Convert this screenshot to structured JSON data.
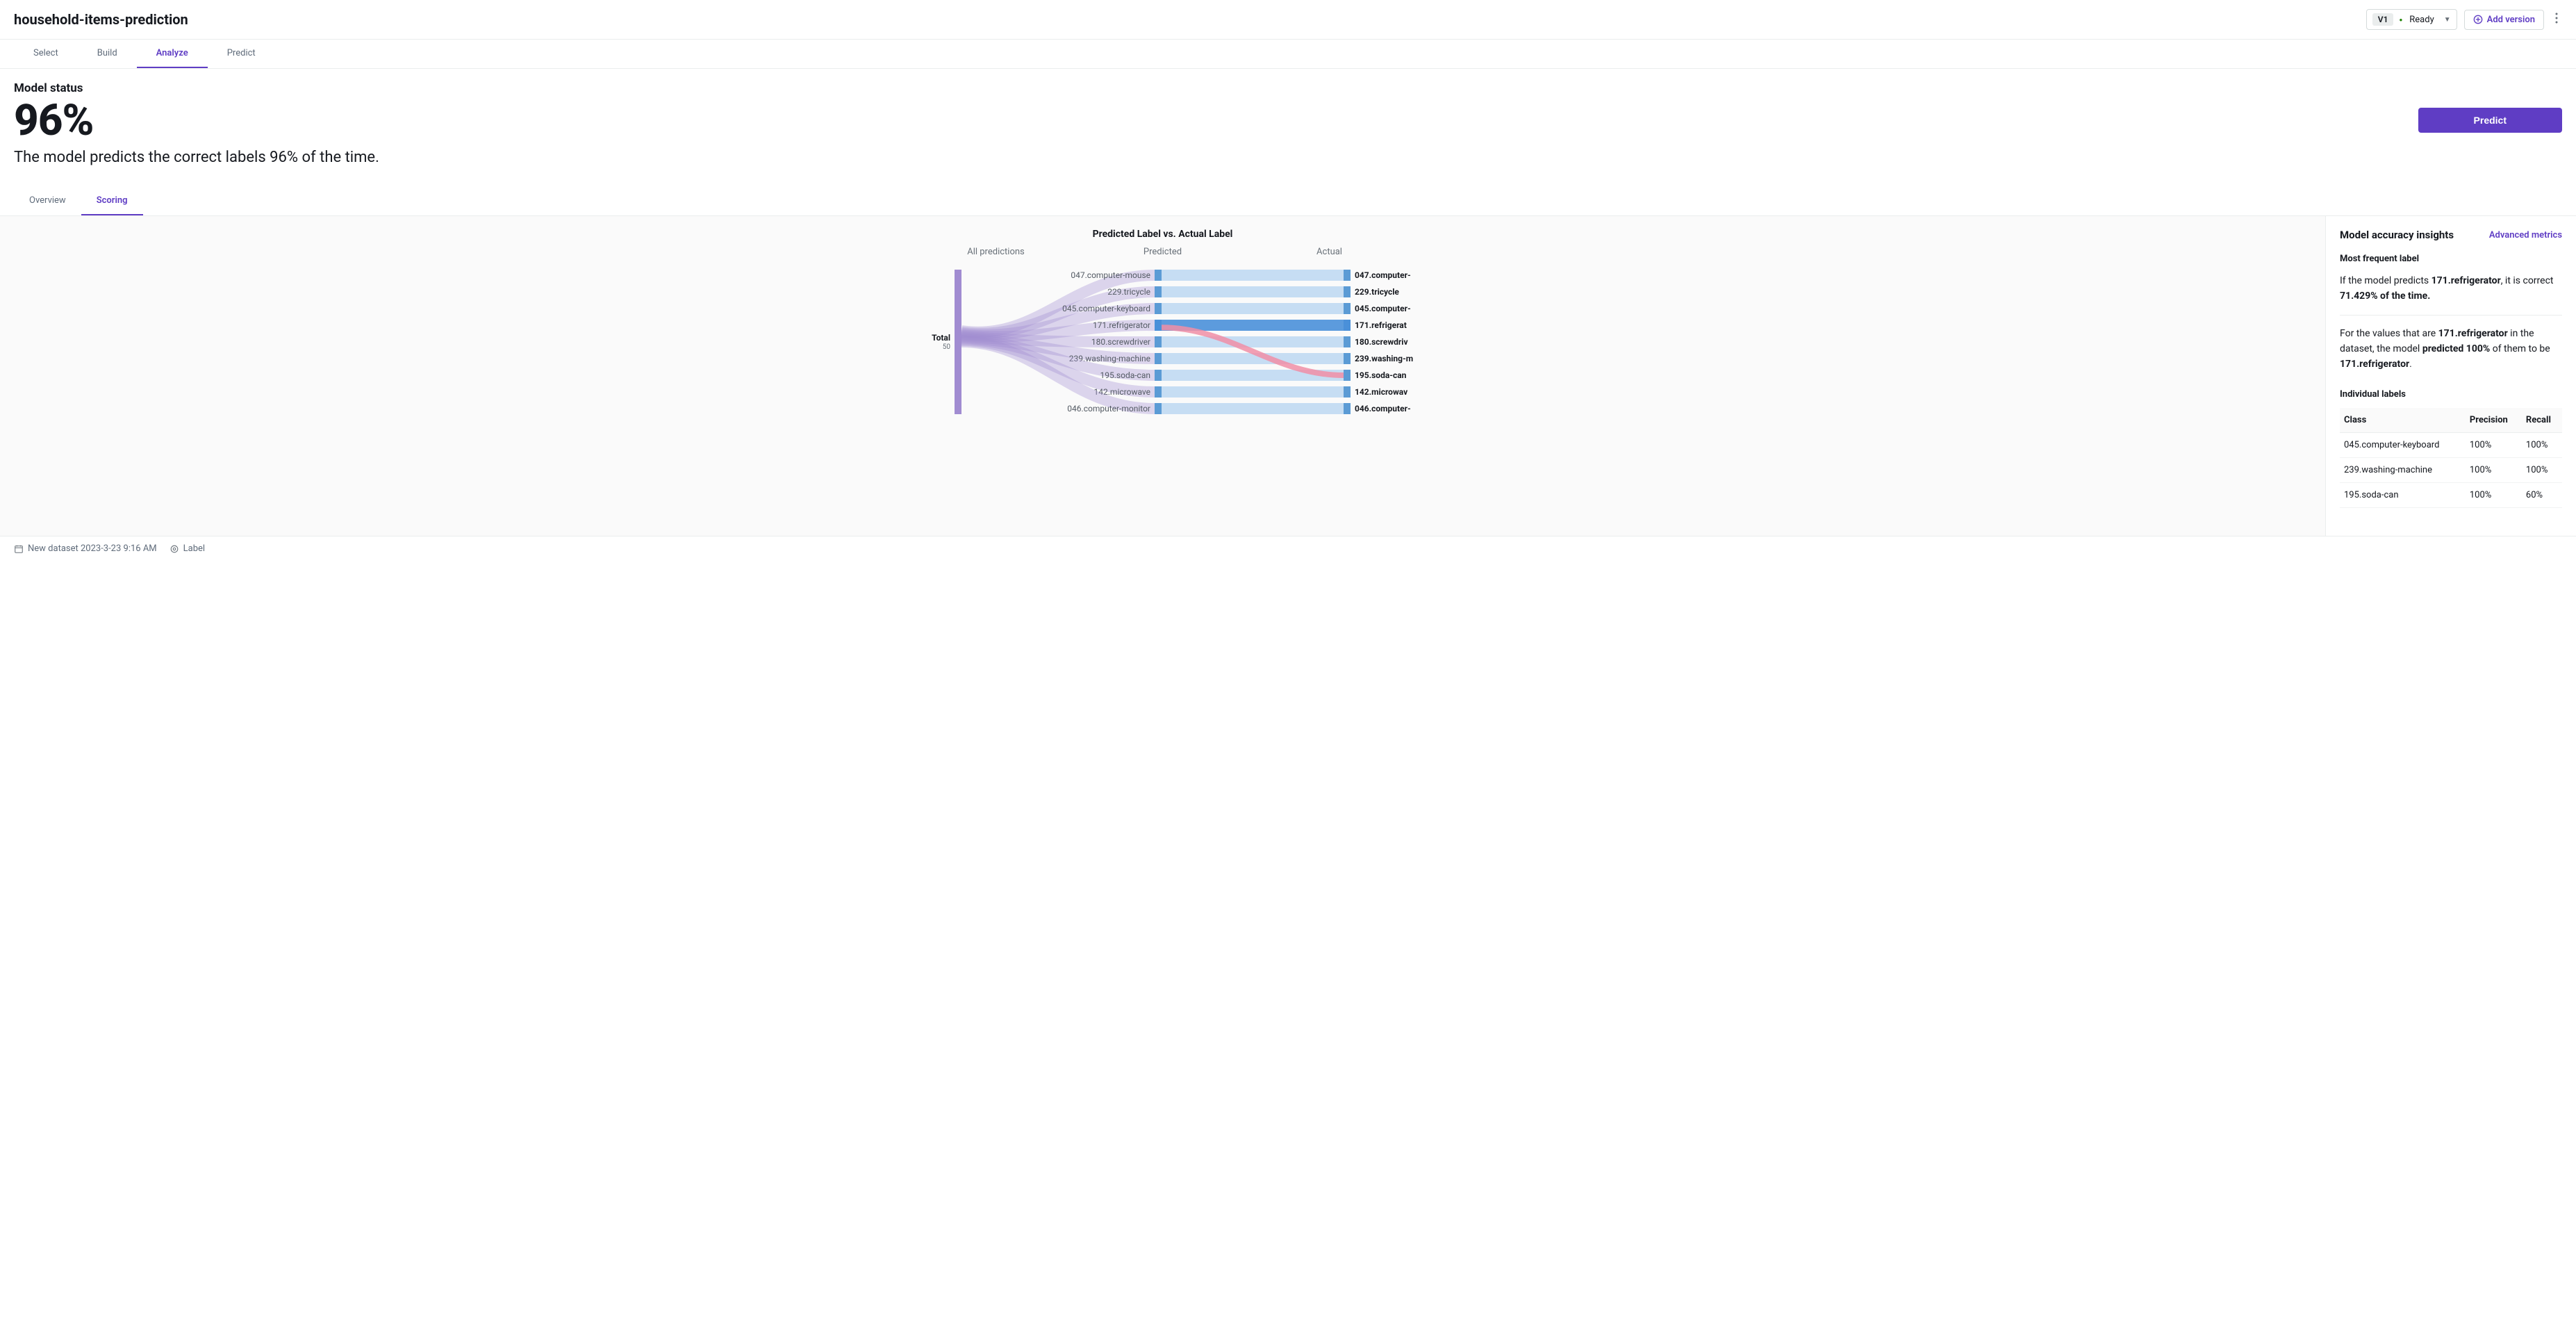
{
  "header": {
    "title": "household-items-prediction",
    "version": "V1",
    "status": "Ready",
    "add_version": "Add version"
  },
  "tabs": {
    "select": "Select",
    "build": "Build",
    "analyze": "Analyze",
    "predict": "Predict"
  },
  "model_status": {
    "heading": "Model status",
    "percent": "96%",
    "description": "The model predicts the correct labels 96% of the time.",
    "predict_btn": "Predict"
  },
  "subtabs": {
    "overview": "Overview",
    "scoring": "Scoring"
  },
  "chart": {
    "title": "Predicted Label vs. Actual Label",
    "col_all": "All predictions",
    "col_pred": "Predicted",
    "col_actual": "Actual",
    "total_label": "Total",
    "total_n": "50"
  },
  "chart_data": {
    "type": "sankey",
    "title": "Predicted Label vs. Actual Label",
    "total": 50,
    "predicted": [
      {
        "label": "047.computer-mouse"
      },
      {
        "label": "229.tricycle"
      },
      {
        "label": "045.computer-keyboard"
      },
      {
        "label": "171.refrigerator"
      },
      {
        "label": "180.screwdriver"
      },
      {
        "label": "239.washing-machine"
      },
      {
        "label": "195.soda-can"
      },
      {
        "label": "142.microwave"
      },
      {
        "label": "046.computer-monitor"
      }
    ],
    "actual": [
      {
        "label": "047.computer-mouse",
        "short": "047.computer-"
      },
      {
        "label": "229.tricycle",
        "short": "229.tricycle"
      },
      {
        "label": "045.computer-keyboard",
        "short": "045.computer-"
      },
      {
        "label": "171.refrigerator",
        "short": "171.refrigerat"
      },
      {
        "label": "180.screwdriver",
        "short": "180.screwdriv"
      },
      {
        "label": "239.washing-machine",
        "short": "239.washing-m"
      },
      {
        "label": "195.soda-can",
        "short": "195.soda-can"
      },
      {
        "label": "142.microwave",
        "short": "142.microwav"
      },
      {
        "label": "046.computer-monitor",
        "short": "046.computer-"
      }
    ],
    "misroute": {
      "from": "171.refrigerator",
      "to": "195.soda-can"
    }
  },
  "insights": {
    "heading": "Model accuracy insights",
    "advanced": "Advanced metrics",
    "mfl": "Most frequent label",
    "p1_a": "If the model predicts ",
    "p1_b": "171.refrigerator",
    "p1_c": ", it is correct ",
    "p1_d": "71.429% of the time.",
    "p2_a": "For the values that are ",
    "p2_b": "171.refrigerator",
    "p2_c": " in the dataset, the model ",
    "p2_d": "predicted 100%",
    "p2_e": " of them to be ",
    "p2_f": "171.refrigerator",
    "p2_g": ".",
    "il_title": "Individual labels",
    "th_class": "Class",
    "th_prec": "Precision",
    "th_rec": "Recall",
    "rows": [
      {
        "class": "045.computer-keyboard",
        "prec": "100%",
        "rec": "100%"
      },
      {
        "class": "239.washing-machine",
        "prec": "100%",
        "rec": "100%"
      },
      {
        "class": "195.soda-can",
        "prec": "100%",
        "rec": "60%"
      }
    ]
  },
  "footer": {
    "dataset": "New dataset 2023-3-23 9:16 AM",
    "target": "Label"
  }
}
